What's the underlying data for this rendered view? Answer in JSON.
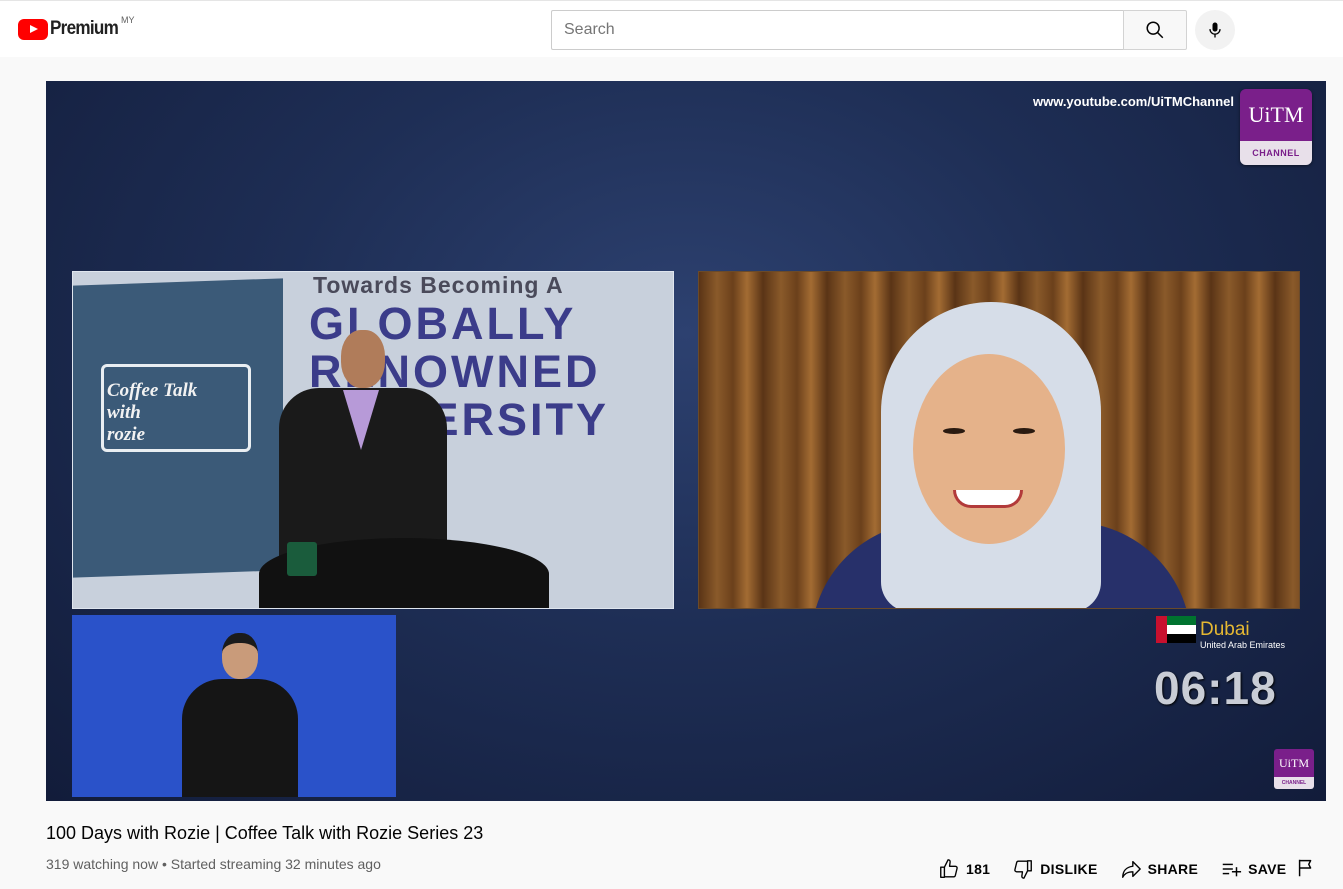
{
  "masthead": {
    "logo_text": "Premium",
    "region": "MY",
    "search_placeholder": "Search"
  },
  "player": {
    "channel_url": "www.youtube.com/UiTMChannel",
    "badge_top": "UiTM",
    "badge_bottom": "CHANNEL",
    "studio_banner_line1": "Towards Becoming A",
    "studio_banner_line2": "GLOBALLY\nRENOWNED\nUNIVERSITY",
    "board_text": "Coffee Talk\nwith\nrozie",
    "location_city": "Dubai",
    "location_country": "United Arab Emirates",
    "clock": "06:18",
    "mini_badge_top": "UiTM",
    "mini_badge_bottom": "CHANNEL"
  },
  "video": {
    "title": "100 Days with Rozie | Coffee Talk with Rozie Series 23",
    "info": "319 watching now • Started streaming 32 minutes ago"
  },
  "actions": {
    "like_count": "181",
    "dislike_label": "DISLIKE",
    "share_label": "SHARE",
    "save_label": "SAVE"
  },
  "colors": {
    "youtube_red": "#ff0000",
    "uitm_purple": "#7a1f8a",
    "player_bg": "#1e2e55"
  }
}
